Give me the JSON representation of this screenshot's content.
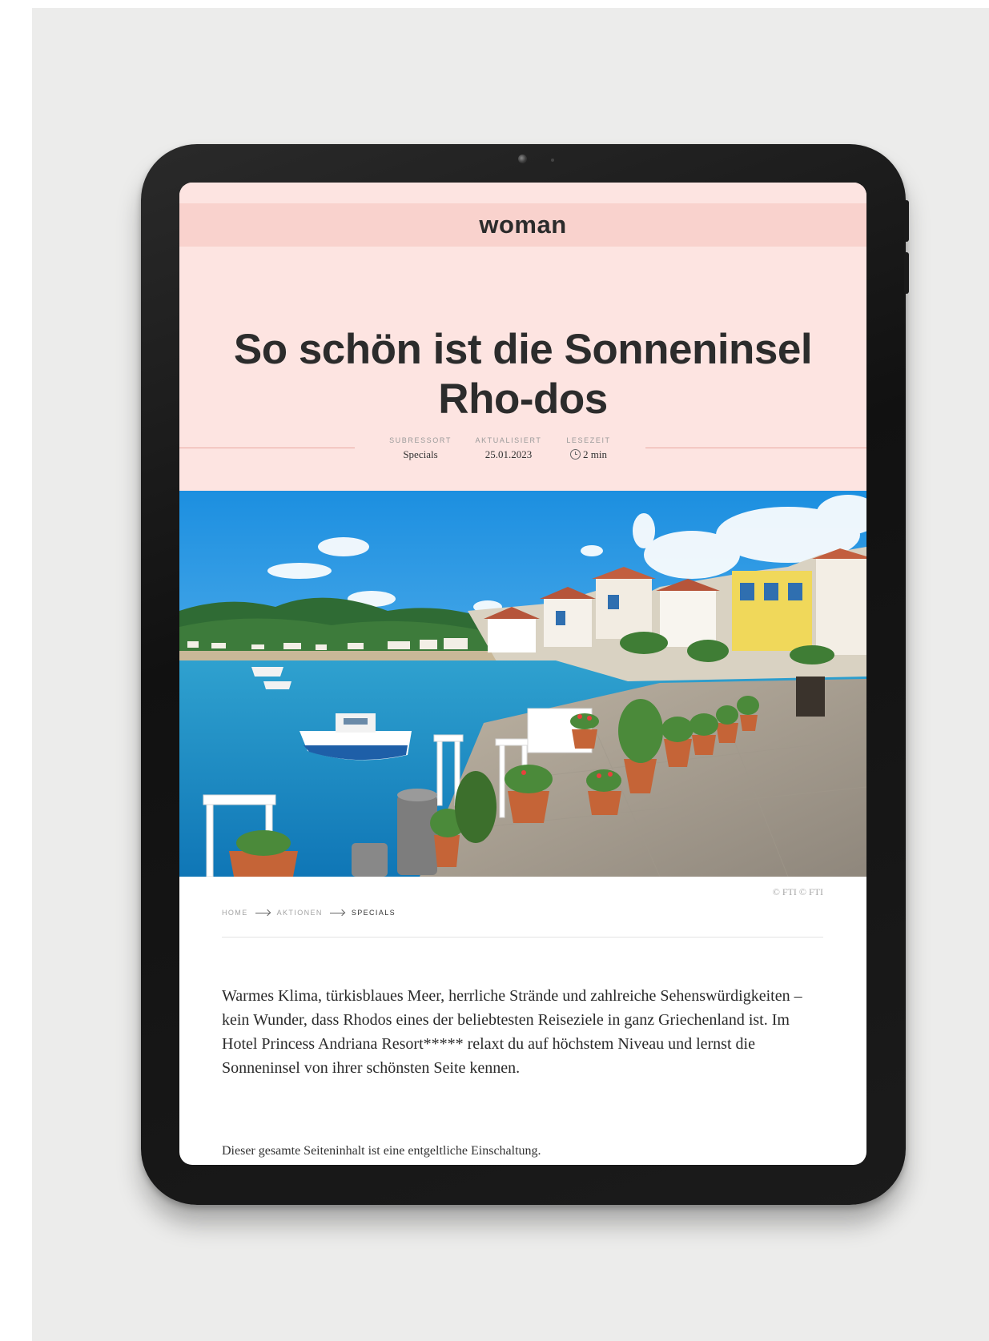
{
  "site": {
    "brand": "woman"
  },
  "article": {
    "title": "So schön ist die Sonneninsel Rho-dos",
    "meta": [
      {
        "label": "SUBRESSORT",
        "value": "Specials"
      },
      {
        "label": "AKTUALISIERT",
        "value": "25.01.2023"
      },
      {
        "label": "LESEZEIT",
        "value": "2 min"
      }
    ],
    "image_credit": "© FTI © FTI",
    "breadcrumb": [
      "HOME",
      "AKTIONEN",
      "SPECIALS"
    ],
    "lead": "Warmes Klima, türkisblaues Meer, herrliche Strände und zahlreiche Sehenswürdigkeiten – kein Wunder, dass Rhodos eines der beliebtesten Reiseziele in ganz Griechenland ist. Im Hotel Princess Andriana Resort***** relaxt du auf höchstem Niveau und lernst die Sonneninsel von ihrer schönsten Seite kennen.",
    "disclaimer": "Dieser gesamte Seiteninhalt ist eine entgeltliche Einschaltung."
  },
  "colors": {
    "brand_bar": "#f9d2cd",
    "hero_bg": "#fde4e1",
    "meta_line": "#e9a9a1",
    "device": "#141414"
  },
  "icons": {
    "reading_time": "clock-icon",
    "breadcrumb_separator": "arrow-right-icon"
  }
}
